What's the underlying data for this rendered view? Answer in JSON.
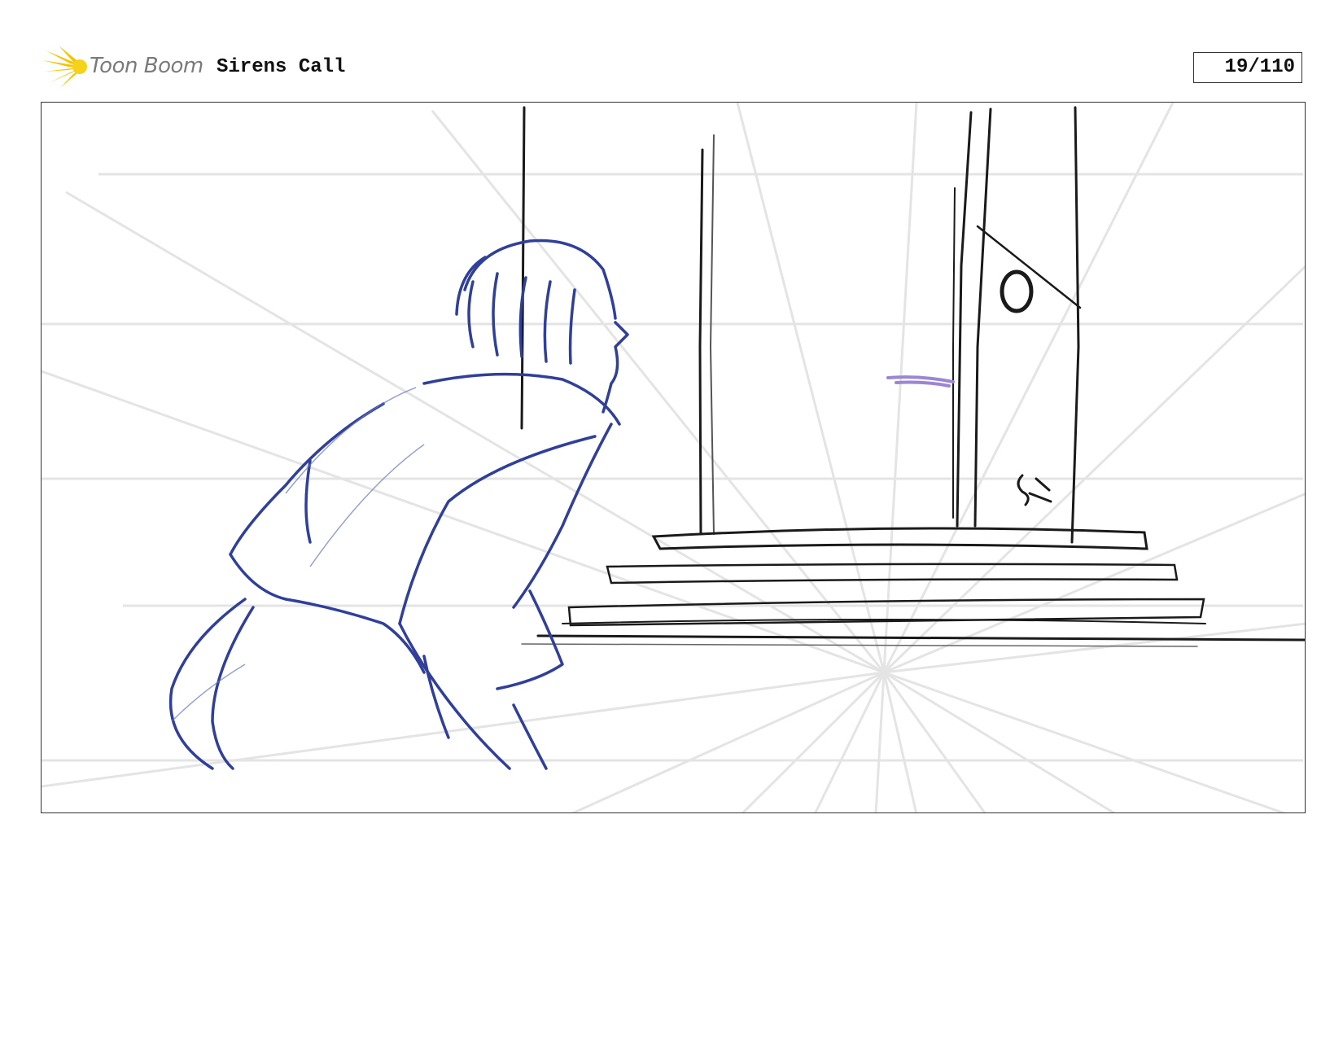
{
  "header": {
    "brand": "Toon Boom",
    "project": "Sirens Call",
    "page_counter": "19/110"
  },
  "colors": {
    "logo_yellow": "#f5c400",
    "character_blue": "#2f3f9a",
    "set_black": "#1a1a1a",
    "guide_gray": "#e2e2e2",
    "accent_purple": "#9b86d6"
  },
  "icons": {
    "logo": "toon-boom-sun-logo-icon"
  }
}
